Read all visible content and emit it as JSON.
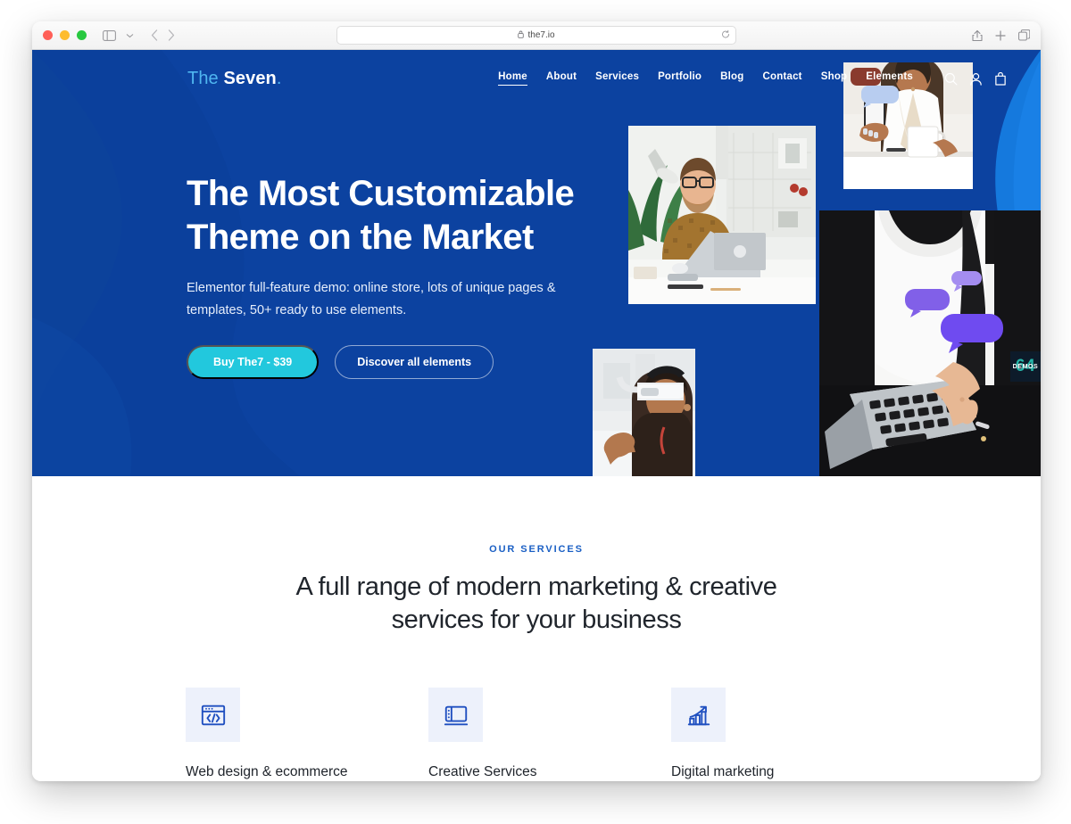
{
  "browser": {
    "url": "the7.io",
    "lock_icon": "lock-icon",
    "sidebar_icon": "sidebar-toggle-icon",
    "chevron_icon": "chevron-down-icon",
    "back_icon": "back-arrow-icon",
    "forward_icon": "forward-arrow-icon",
    "reload_icon": "reload-icon",
    "share_icon": "share-icon",
    "new_tab_icon": "plus-icon",
    "tabs_icon": "tab-overview-icon"
  },
  "site": {
    "logo": {
      "part1": "The",
      "part2": "Seven",
      "part3": "."
    },
    "nav": [
      {
        "label": "Home",
        "active": true
      },
      {
        "label": "About",
        "active": false
      },
      {
        "label": "Services",
        "active": false
      },
      {
        "label": "Portfolio",
        "active": false
      },
      {
        "label": "Blog",
        "active": false
      },
      {
        "label": "Contact",
        "active": false
      },
      {
        "label": "Shop",
        "active": false
      },
      {
        "label": "Elements",
        "active": false
      }
    ],
    "nav_icons": [
      "search-icon",
      "user-account-icon",
      "shopping-bag-icon"
    ],
    "colors": {
      "hero_base": "#0c42a0",
      "hero_wave_light": "#1155c2",
      "hero_right": "#1579dd",
      "accent_cyan": "#22c8dd",
      "logo_accent": "#4fb6f0",
      "eyebrow_blue": "#1a5fc4",
      "icon_blue": "#1f4fc0",
      "icon_tile_bg": "#edf1fb",
      "heading_dark": "#20252c"
    }
  },
  "hero": {
    "title_line1": "The Most Customizable",
    "title_line2": "Theme on the Market",
    "subtitle": "Elementor full-feature demo: online store, lots of unique pages & templates, 50+ ready to use elements.",
    "primary_button": "Buy The7 - $39",
    "outline_button": "Discover all elements",
    "demos_tab": "DEMOS",
    "demos_ghost": "64",
    "photos": [
      {
        "name": "photo-man-at-desk-laptop"
      },
      {
        "name": "photo-woman-phone-mug"
      },
      {
        "name": "photo-woman-laptop-chat-bubbles"
      },
      {
        "name": "photo-woman-vr-headset"
      }
    ]
  },
  "services": {
    "eyebrow": "OUR SERVICES",
    "title_line1": "A full range of modern marketing & creative",
    "title_line2": "services for your business",
    "cards": [
      {
        "title": "Web design & ecommerce",
        "icon": "code-window-icon"
      },
      {
        "title": "Creative Services",
        "icon": "presentation-layout-icon"
      },
      {
        "title": "Digital marketing",
        "icon": "growth-chart-icon"
      }
    ]
  }
}
